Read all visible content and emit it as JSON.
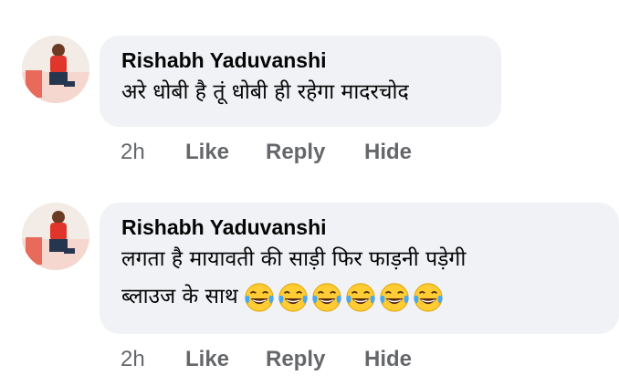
{
  "comments": [
    {
      "author": "Rishabh Yaduvanshi",
      "text": "अरे धोबी है तूं धोबी ही रहेगा मादरचोद",
      "emoji_count": 0,
      "time": "2h",
      "like_label": "Like",
      "reply_label": "Reply",
      "hide_label": "Hide"
    },
    {
      "author": "Rishabh Yaduvanshi",
      "text_line1": "लगता है मायावती की साड़ी फिर फाड़नी पड़ेगी",
      "text_line2": "ब्लाउज के साथ",
      "emoji": "face-with-tears-of-joy",
      "emoji_count": 6,
      "time": "2h",
      "like_label": "Like",
      "reply_label": "Reply",
      "hide_label": "Hide"
    }
  ],
  "colors": {
    "bubble": "#f0f2f5",
    "author": "#050505",
    "meta": "#65676b",
    "emoji_face": "#ffcc33"
  }
}
